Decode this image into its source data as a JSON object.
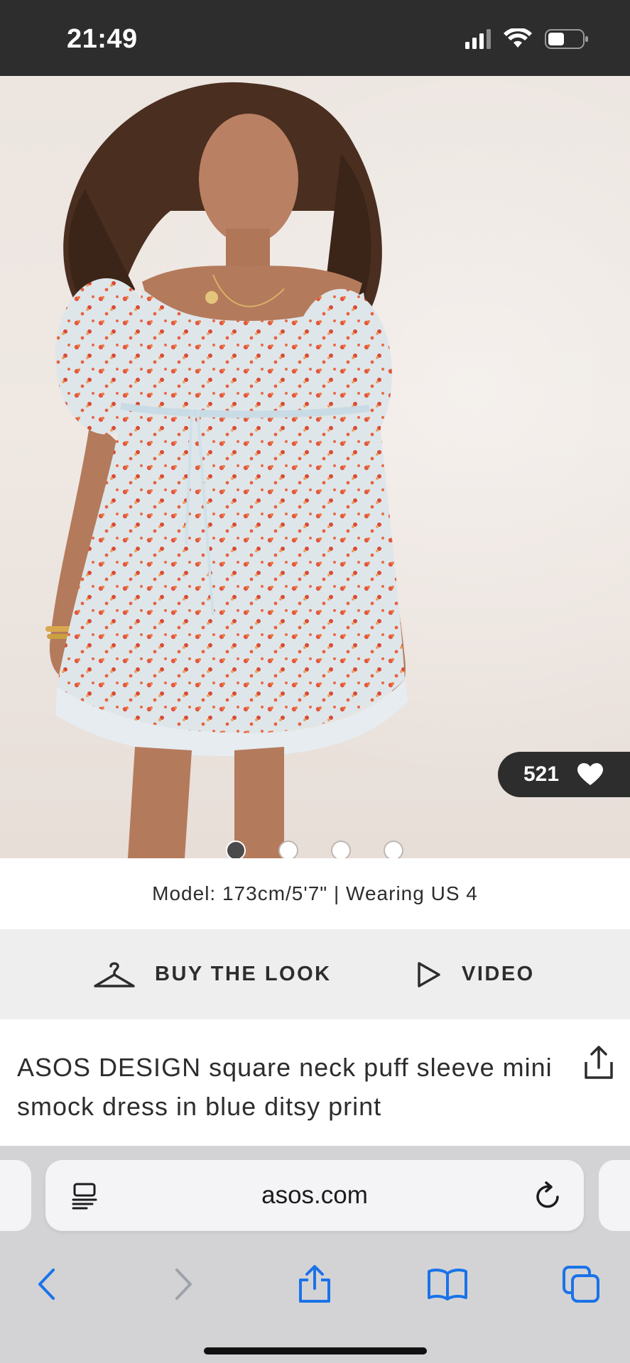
{
  "status_bar": {
    "time": "21:49"
  },
  "product": {
    "likes": "521",
    "carousel": {
      "total": 4,
      "active_index": 0
    },
    "model_info": "Model: 173cm/5'7\" | Wearing US 4",
    "buy_the_look_label": "BUY THE LOOK",
    "video_label": "VIDEO",
    "title": "ASOS DESIGN square neck puff sleeve mini smock dress in blue ditsy print"
  },
  "browser": {
    "url": "asos.com"
  },
  "colors": {
    "dark": "#2d2d2d",
    "action_bar_bg": "#eeeeee",
    "safari_blue": "#1a73e8",
    "safari_chrome": "#d3d3d6"
  },
  "icons": {
    "signal": "cellular-signal-icon",
    "wifi": "wifi-icon",
    "battery": "battery-icon",
    "heart": "heart-icon",
    "hanger": "hanger-icon",
    "play": "play-icon",
    "share": "share-icon",
    "reader": "reader-mode-icon",
    "reload": "reload-icon",
    "back": "back-arrow-icon",
    "forward": "forward-arrow-icon",
    "bookmarks": "bookmarks-icon",
    "tabs": "tabs-icon"
  }
}
